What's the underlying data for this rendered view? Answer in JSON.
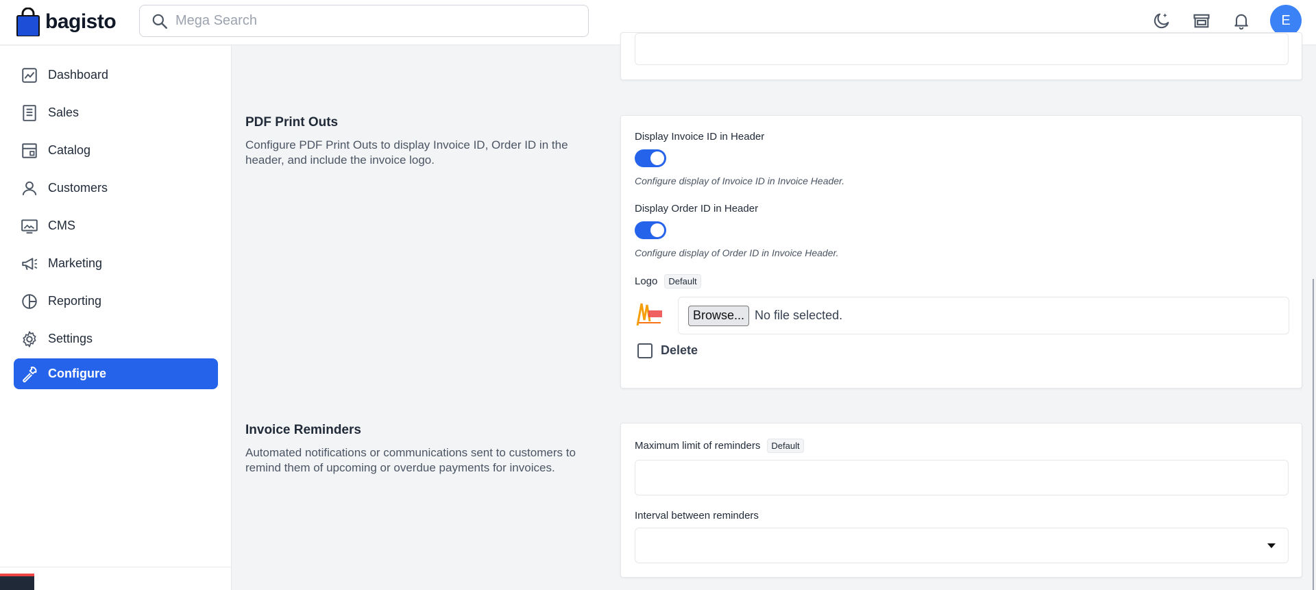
{
  "header": {
    "brand": "bagisto",
    "search_placeholder": "Mega Search",
    "avatar_initial": "E"
  },
  "sidebar": {
    "items": [
      {
        "label": "Dashboard",
        "icon": "dashboard-icon"
      },
      {
        "label": "Sales",
        "icon": "sales-icon"
      },
      {
        "label": "Catalog",
        "icon": "catalog-icon"
      },
      {
        "label": "Customers",
        "icon": "customers-icon"
      },
      {
        "label": "CMS",
        "icon": "cms-icon"
      },
      {
        "label": "Marketing",
        "icon": "marketing-icon"
      },
      {
        "label": "Reporting",
        "icon": "reporting-icon"
      },
      {
        "label": "Settings",
        "icon": "settings-icon"
      },
      {
        "label": "Configure",
        "icon": "configure-icon",
        "active": true
      }
    ]
  },
  "pdf_section": {
    "title": "PDF Print Outs",
    "description": "Configure PDF Print Outs to display Invoice ID, Order ID in the header, and include the invoice logo.",
    "invoice_id_label": "Display Invoice ID in Header",
    "invoice_id_enabled": true,
    "invoice_id_hint": "Configure display of Invoice ID in Invoice Header.",
    "order_id_label": "Display Order ID in Header",
    "order_id_enabled": true,
    "order_id_hint": "Configure display of Order ID in Invoice Header.",
    "logo_label": "Logo",
    "logo_badge": "Default",
    "browse_label": "Browse...",
    "file_status": "No file selected.",
    "delete_label": "Delete"
  },
  "reminders_section": {
    "title": "Invoice Reminders",
    "description": "Automated notifications or communications sent to customers to remind them of upcoming or overdue payments for invoices.",
    "max_limit_label": "Maximum limit of reminders",
    "max_limit_badge": "Default",
    "max_limit_value": "",
    "interval_label": "Interval between reminders",
    "interval_value": ""
  },
  "colors": {
    "accent": "#2563eb",
    "avatar": "#3b82f6"
  }
}
